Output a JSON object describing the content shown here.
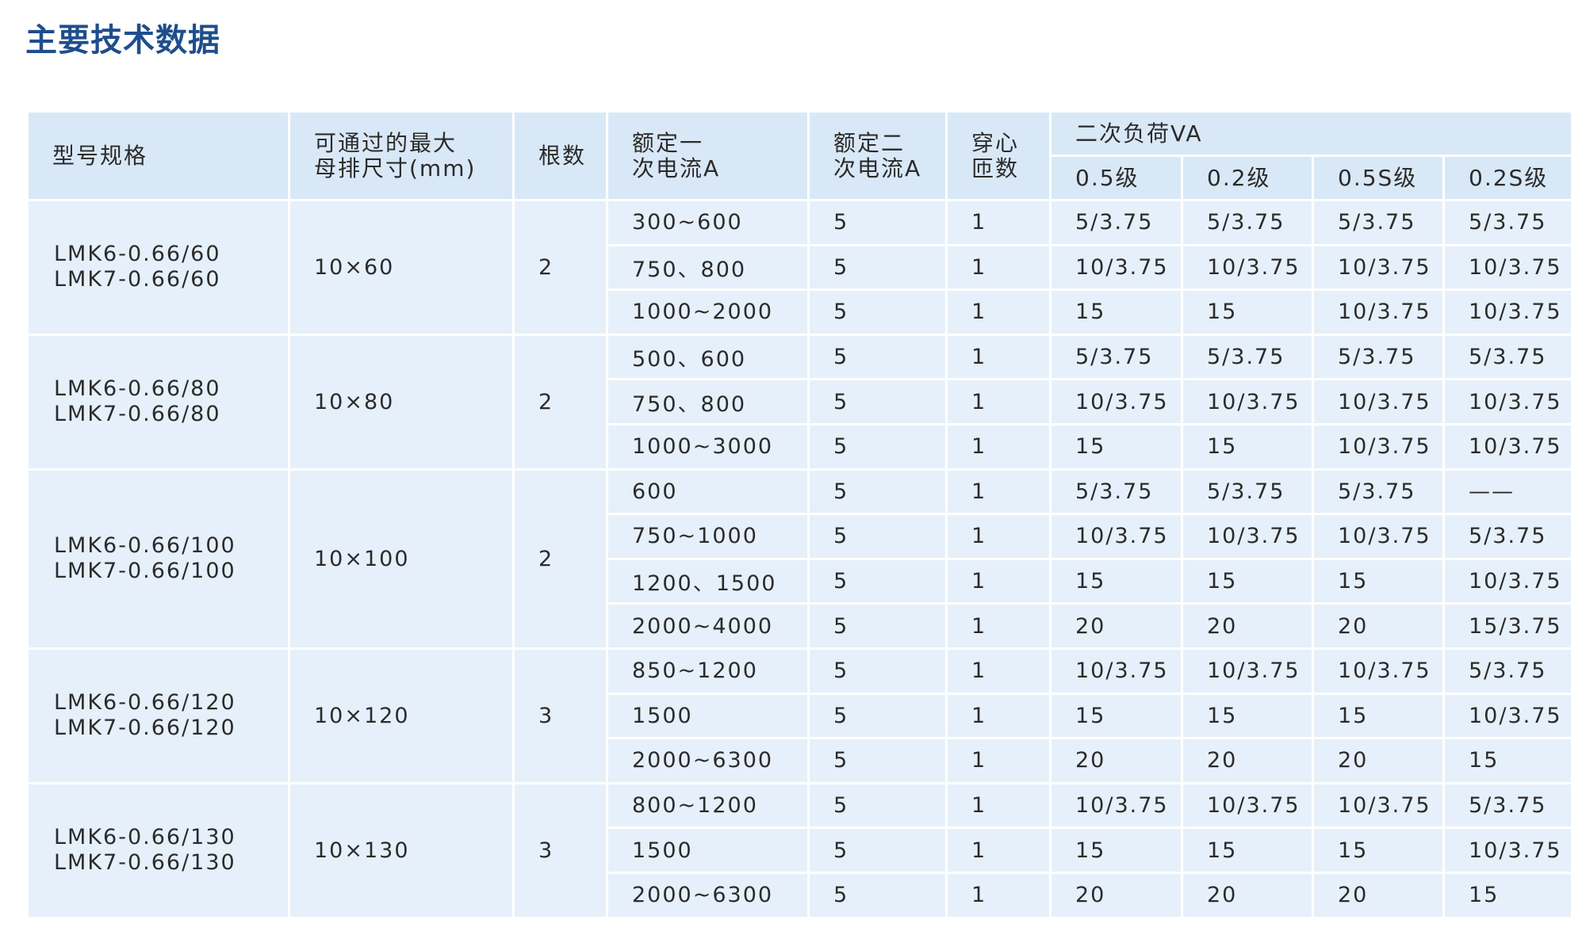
{
  "title": "主要技术数据",
  "table": {
    "headers": {
      "model": "型号规格",
      "busbar": [
        "可通过的最大",
        "母排尺寸(mm)"
      ],
      "count": "根数",
      "primary": [
        "额定一",
        "次电流A"
      ],
      "secondary": [
        "额定二",
        "次电流A"
      ],
      "turns": [
        "穿心",
        "匝数"
      ],
      "load_group": "二次负荷VA",
      "load_classes": [
        "0.5级",
        "0.2级",
        "0.5S级",
        "0.2S级"
      ]
    },
    "groups": [
      {
        "models": [
          "LMK6-0.66/60",
          "LMK7-0.66/60"
        ],
        "busbar": "10×60",
        "count": "2",
        "rows": [
          {
            "primary": "300~600",
            "secondary": "5",
            "turns": "1",
            "loads": [
              "5/3.75",
              "5/3.75",
              "5/3.75",
              "5/3.75"
            ]
          },
          {
            "primary": "750、800",
            "secondary": "5",
            "turns": "1",
            "loads": [
              "10/3.75",
              "10/3.75",
              "10/3.75",
              "10/3.75"
            ]
          },
          {
            "primary": "1000~2000",
            "secondary": "5",
            "turns": "1",
            "loads": [
              "15",
              "15",
              "10/3.75",
              "10/3.75"
            ]
          }
        ]
      },
      {
        "models": [
          "LMK6-0.66/80",
          "LMK7-0.66/80"
        ],
        "busbar": "10×80",
        "count": "2",
        "rows": [
          {
            "primary": "500、600",
            "secondary": "5",
            "turns": "1",
            "loads": [
              "5/3.75",
              "5/3.75",
              "5/3.75",
              "5/3.75"
            ]
          },
          {
            "primary": "750、800",
            "secondary": "5",
            "turns": "1",
            "loads": [
              "10/3.75",
              "10/3.75",
              "10/3.75",
              "10/3.75"
            ]
          },
          {
            "primary": "1000~3000",
            "secondary": "5",
            "turns": "1",
            "loads": [
              "15",
              "15",
              "10/3.75",
              "10/3.75"
            ]
          }
        ]
      },
      {
        "models": [
          "LMK6-0.66/100",
          "LMK7-0.66/100"
        ],
        "busbar": "10×100",
        "count": "2",
        "rows": [
          {
            "primary": "600",
            "secondary": "5",
            "turns": "1",
            "loads": [
              "5/3.75",
              "5/3.75",
              "5/3.75",
              "——"
            ]
          },
          {
            "primary": "750~1000",
            "secondary": "5",
            "turns": "1",
            "loads": [
              "10/3.75",
              "10/3.75",
              "10/3.75",
              "5/3.75"
            ]
          },
          {
            "primary": "1200、1500",
            "secondary": "5",
            "turns": "1",
            "loads": [
              "15",
              "15",
              "15",
              "10/3.75"
            ]
          },
          {
            "primary": "2000~4000",
            "secondary": "5",
            "turns": "1",
            "loads": [
              "20",
              "20",
              "20",
              "15/3.75"
            ]
          }
        ]
      },
      {
        "models": [
          "LMK6-0.66/120",
          "LMK7-0.66/120"
        ],
        "busbar": "10×120",
        "count": "3",
        "rows": [
          {
            "primary": "850~1200",
            "secondary": "5",
            "turns": "1",
            "loads": [
              "10/3.75",
              "10/3.75",
              "10/3.75",
              "5/3.75"
            ]
          },
          {
            "primary": "1500",
            "secondary": "5",
            "turns": "1",
            "loads": [
              "15",
              "15",
              "15",
              "10/3.75"
            ]
          },
          {
            "primary": "2000~6300",
            "secondary": "5",
            "turns": "1",
            "loads": [
              "20",
              "20",
              "20",
              "15"
            ]
          }
        ]
      },
      {
        "models": [
          "LMK6-0.66/130",
          "LMK7-0.66/130"
        ],
        "busbar": "10×130",
        "count": "3",
        "rows": [
          {
            "primary": "800~1200",
            "secondary": "5",
            "turns": "1",
            "loads": [
              "10/3.75",
              "10/3.75",
              "10/3.75",
              "5/3.75"
            ]
          },
          {
            "primary": "1500",
            "secondary": "5",
            "turns": "1",
            "loads": [
              "15",
              "15",
              "15",
              "10/3.75"
            ]
          },
          {
            "primary": "2000~6300",
            "secondary": "5",
            "turns": "1",
            "loads": [
              "20",
              "20",
              "20",
              "15"
            ]
          }
        ]
      }
    ]
  }
}
